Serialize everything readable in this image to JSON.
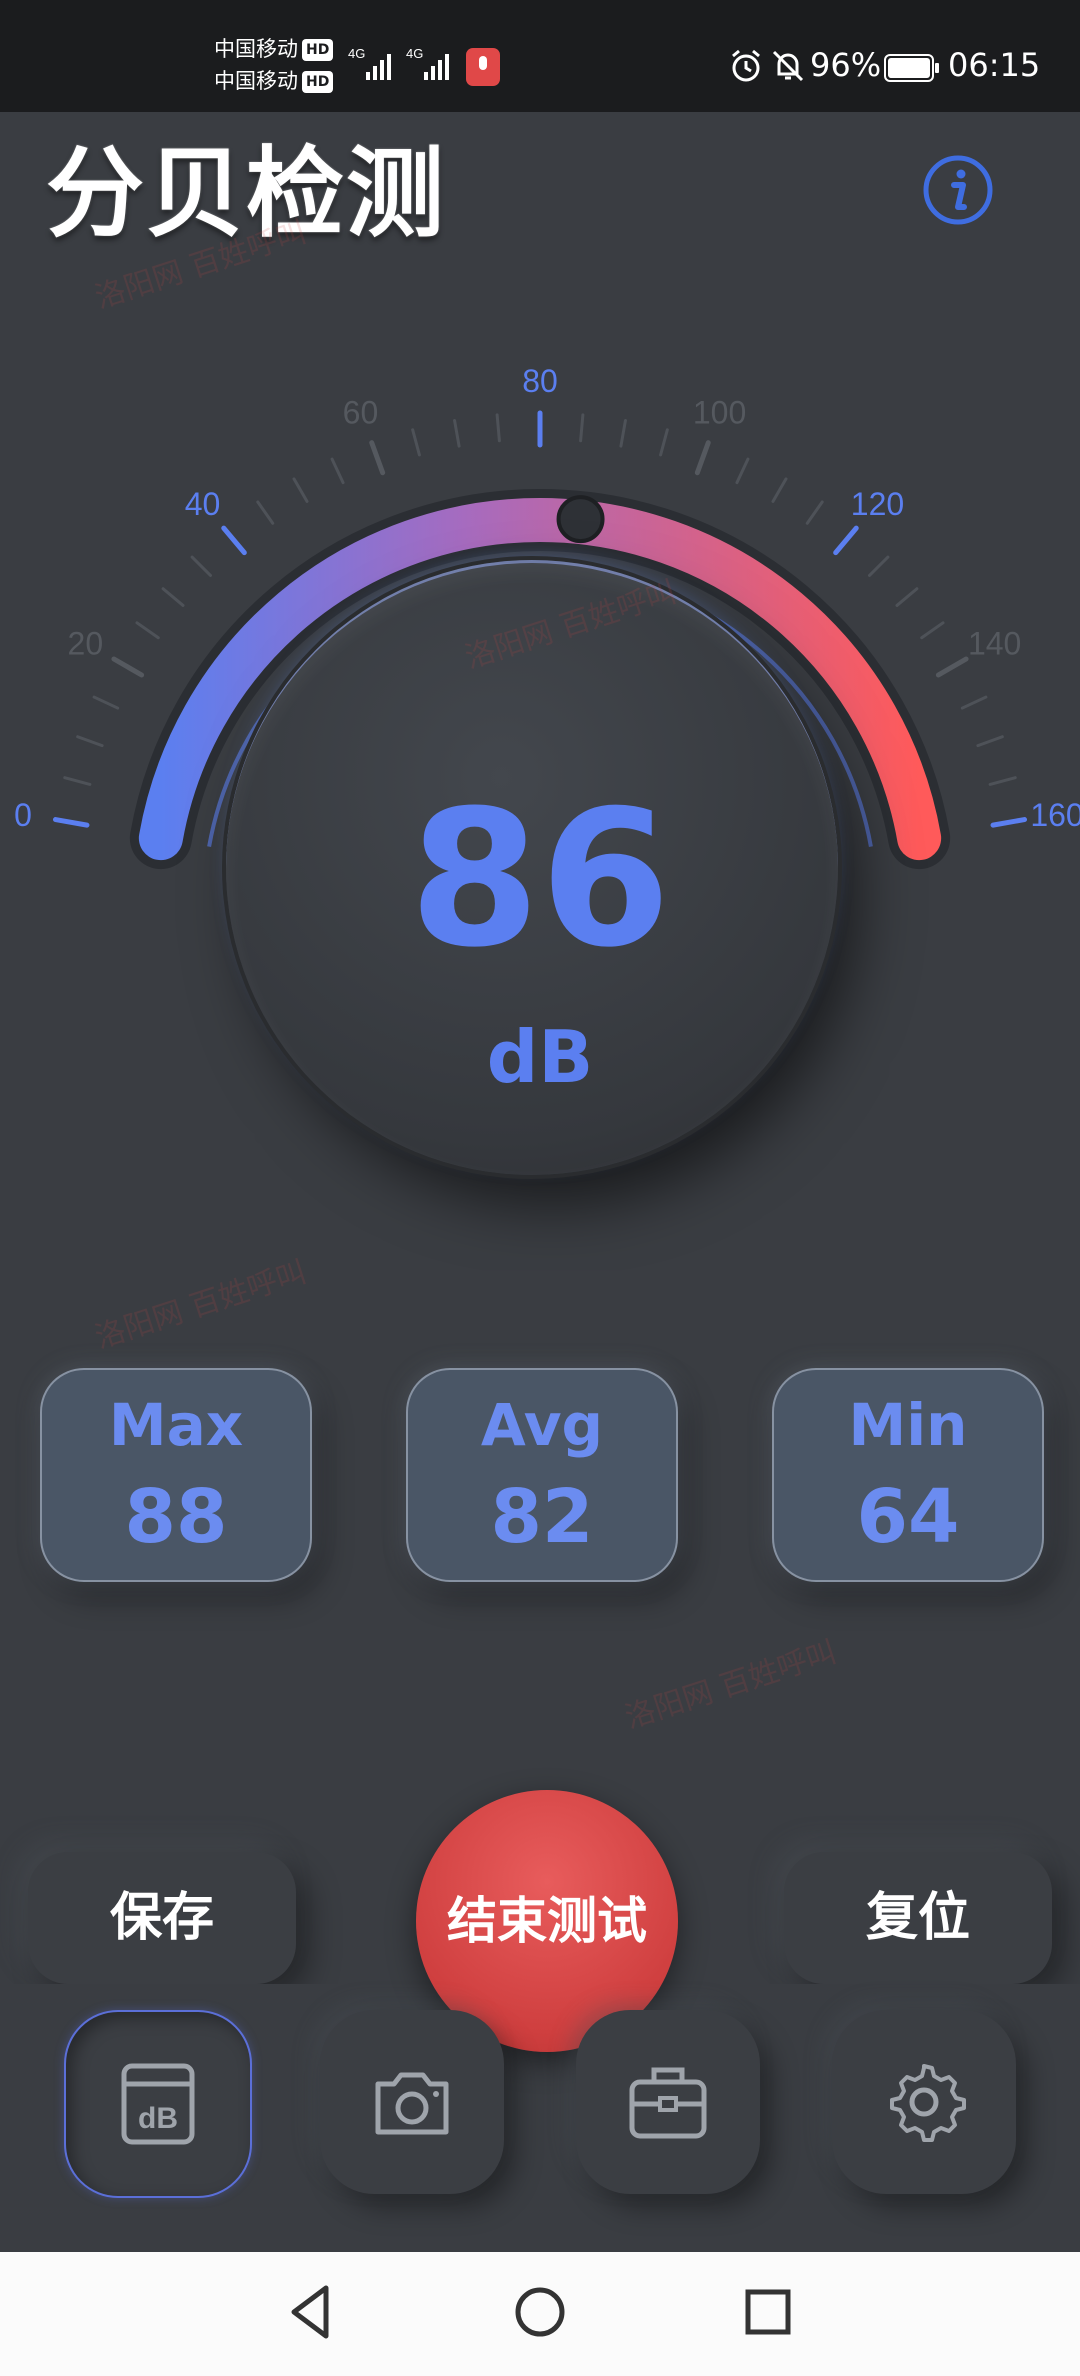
{
  "status_bar": {
    "carrier1": "中国移动",
    "carrier2": "中国移动",
    "hd": "HD",
    "net1": "4G",
    "net2": "4G",
    "battery": "96%",
    "time": "06:15"
  },
  "header": {
    "title": "分贝检测",
    "info_icon": "info-icon"
  },
  "gauge": {
    "value": 86,
    "unit": "dB",
    "min": 0,
    "max": 160,
    "tick_labels": [
      "0",
      "20",
      "40",
      "60",
      "80",
      "100",
      "120",
      "140",
      "160"
    ],
    "colors": {
      "start": "#5b7ff0",
      "mid": "#a66bbf",
      "end": "#ff5a5a"
    }
  },
  "stats": [
    {
      "label": "Max",
      "value": "88"
    },
    {
      "label": "Avg",
      "value": "82"
    },
    {
      "label": "Min",
      "value": "64"
    }
  ],
  "actions": {
    "save": "保存",
    "stop": "结束测试",
    "reset": "复位"
  },
  "tabs": [
    {
      "icon": "db-meter-icon",
      "active": true
    },
    {
      "icon": "camera-icon",
      "active": false
    },
    {
      "icon": "toolbox-icon",
      "active": false
    },
    {
      "icon": "settings-gear-icon",
      "active": false
    }
  ],
  "watermark": "洛阳网 百姓呼叫"
}
